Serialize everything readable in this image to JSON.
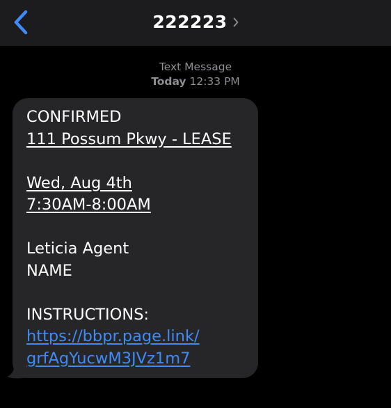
{
  "header": {
    "back_icon": "chevron-left-icon",
    "contact": "222223",
    "contact_chevron_icon": "chevron-right-icon"
  },
  "thread": {
    "service": "Text Message",
    "day": "Today",
    "time": "12:33 PM"
  },
  "message": {
    "line_status": "CONFIRMED",
    "line_address": "111 Possum Pkwy - LEASE",
    "line_date": "Wed, Aug 4th",
    "line_time": "7:30AM-8:00AM",
    "line_agent": "Leticia Agent",
    "line_name": "NAME",
    "line_instructions": "INSTRUCTIONS:",
    "link_part1": "https://bbpr.page.link/",
    "link_part2": "grfAgYucwM3JVz1m7"
  },
  "colors": {
    "background": "#000000",
    "nav_bar": "#1c1c1e",
    "bubble": "#262628",
    "accent_blue": "#3e8bf7",
    "meta_gray": "#8e8e93"
  }
}
